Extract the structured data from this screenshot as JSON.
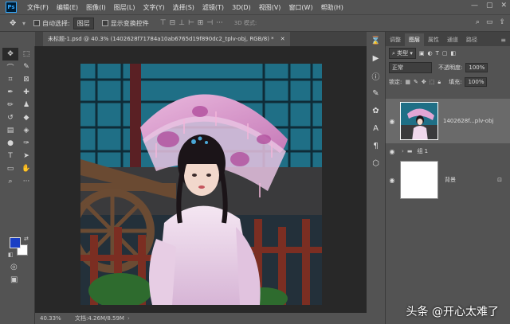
{
  "app": {
    "logo": "Ps"
  },
  "menu": [
    "文件(F)",
    "编辑(E)",
    "图像(I)",
    "图层(L)",
    "文字(Y)",
    "选择(S)",
    "滤镜(T)",
    "3D(D)",
    "视图(V)",
    "窗口(W)",
    "帮助(H)"
  ],
  "window_controls": {
    "minimize": "—",
    "maximize": "▢",
    "close": "✕"
  },
  "options": {
    "auto_select_label": "自动选择:",
    "auto_select_value": "图层",
    "show_transform_label": "显示变换控件",
    "mode_3d_label": "3D 模式:",
    "more": "···"
  },
  "document": {
    "tab_title": "未标题-1.psd @ 40.3% (1402628f71784a10ab6765d19f890dc2_tplv-obj, RGB/8) *",
    "close": "✕"
  },
  "status": {
    "zoom": "40.33%",
    "doc_info": "文档:4.26M/8.59M"
  },
  "panel": {
    "tabs": [
      "调整",
      "图层",
      "属性",
      "通道",
      "路径"
    ],
    "active_tab": "图层",
    "filter_type": "类型",
    "blend_mode": "正常",
    "opacity_label": "不透明度:",
    "opacity_value": "100%",
    "lock_label": "锁定:",
    "fill_label": "填充:",
    "fill_value": "100%",
    "close": "✕"
  },
  "layers": [
    {
      "name": "1402628f...plv-obj",
      "visible": true,
      "selected": true,
      "type": "image"
    },
    {
      "name": "组 1",
      "visible": true,
      "selected": false,
      "type": "group"
    },
    {
      "name": "背景",
      "visible": true,
      "selected": false,
      "type": "background",
      "locked": true
    }
  ],
  "swatches": {
    "foreground": "#1a3fc4",
    "background": "#ffffff"
  },
  "watermark": "头条 @开心太难了"
}
